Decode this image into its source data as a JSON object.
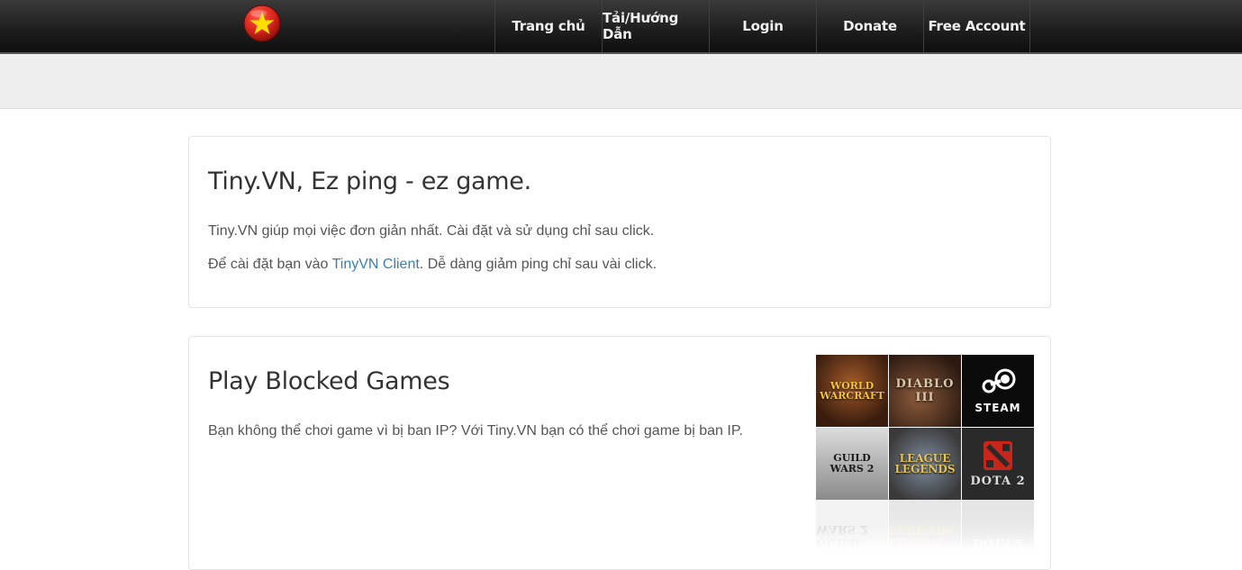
{
  "nav": {
    "items": [
      {
        "label": "Trang chủ"
      },
      {
        "label": "Tải/Hướng Dẫn"
      },
      {
        "label": "Login"
      },
      {
        "label": "Donate"
      },
      {
        "label": "Free Account"
      }
    ]
  },
  "logo": {
    "icon": "vietnam-flag-star-icon",
    "colors": {
      "red": "#da251d",
      "star": "#ffde00"
    }
  },
  "intro": {
    "heading": "Tiny.VN, Ez ping - ez game.",
    "line1": "Tiny.VN giúp mọi việc đơn giản nhất. Cài đặt và sử dụng chỉ sau click.",
    "line2_prefix": "Để cài đặt bạn vào ",
    "line2_link": "TinyVN Client",
    "line2_suffix": ". Dễ dàng giảm ping chỉ sau vài click."
  },
  "blocked": {
    "heading": "Play Blocked Games",
    "text": "Bạn không thể chơi game vì bị ban IP? Với Tiny.VN bạn có thể chơi game bị ban IP."
  },
  "games": [
    {
      "name": "WORLD WARCRAFT",
      "icon": "world-of-warcraft-icon"
    },
    {
      "name": "DIABLO III",
      "icon": "diablo-icon"
    },
    {
      "name": "STEAM",
      "icon": "steam-icon"
    },
    {
      "name": "GUILD WARS 2",
      "icon": "guild-wars-icon"
    },
    {
      "name": "LEAGUE LEGENDS",
      "icon": "league-of-legends-icon"
    },
    {
      "name": "DOTA 2",
      "icon": "dota-icon"
    }
  ]
}
